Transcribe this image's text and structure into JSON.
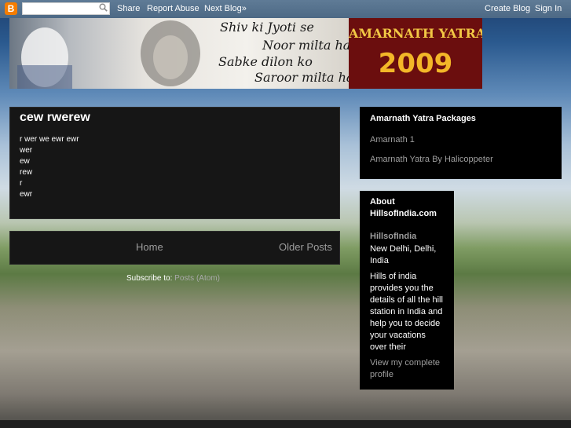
{
  "navbar": {
    "logo": "B",
    "search_placeholder": "",
    "share": "Share",
    "report_abuse": "Report Abuse",
    "next_blog": "Next Blog»",
    "create_blog": "Create Blog",
    "sign_in": "Sign In"
  },
  "header": {
    "script_lines": [
      "Shiv ki Jyoti se",
      "Noor milta hai",
      "Sabke dilon ko",
      "Saroor milta hai,"
    ],
    "title": "AMARNATH YATRA",
    "year": "2009"
  },
  "post": {
    "title": "cew rwerew",
    "lines": [
      "r wer we ewr ewr",
      "wer",
      "ew",
      "rew",
      "r",
      "ewr"
    ]
  },
  "pager": {
    "home": "Home",
    "older": "Older Posts"
  },
  "subscribe": {
    "label": "Subscribe to:",
    "link": "Posts (Atom)"
  },
  "sidebar": {
    "packages": {
      "title": "Amarnath Yatra Packages",
      "links": [
        "Amarnath 1",
        "Amarnath Yatra By Halicoppeter"
      ]
    },
    "about": {
      "title_line1": "About",
      "title_line2": "HillsofIndia.com",
      "name": "HillsofIndia",
      "location_line1": "New Delhi, Delhi,",
      "location_line2": "India",
      "desc_lines": [
        "Hills of india",
        "provides you the",
        "details of all the hill",
        "station in India and",
        "help you to decide",
        "your vacations",
        "over their"
      ],
      "profile_line1": "View my complete",
      "profile_line2": "profile"
    }
  }
}
